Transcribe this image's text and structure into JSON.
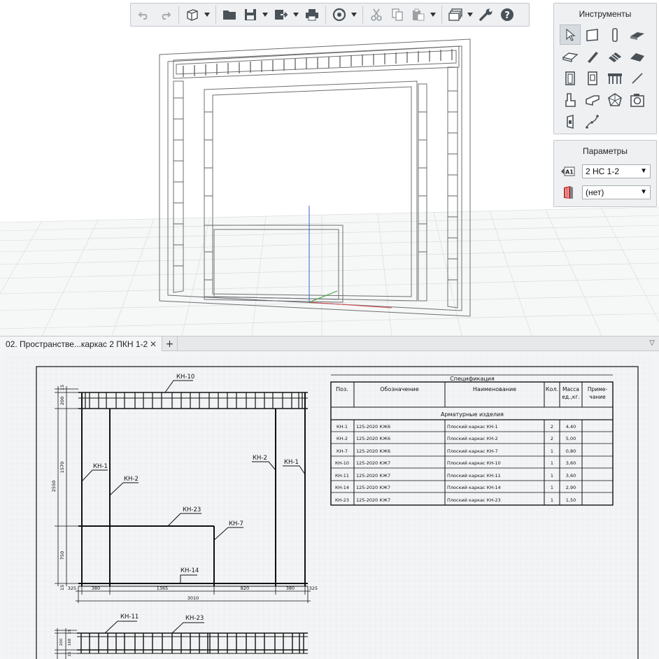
{
  "toolbar": {
    "buttons": [
      "undo-icon",
      "redo-icon",
      "new-3d-icon",
      "open-folder-icon",
      "save-icon",
      "export-icon",
      "print-icon",
      "sync-icon",
      "cut-icon",
      "copy-icon",
      "paste-icon",
      "layers-icon",
      "settings-wrench-icon",
      "help-icon"
    ]
  },
  "tools_panel": {
    "title": "Инструменты"
  },
  "params_panel": {
    "title": "Параметры",
    "style_badge": "A1",
    "style_value": "2 НС 1-2",
    "material_value": "(нет)"
  },
  "tabs": {
    "active_label": "02. Пространстве...каркас 2 ПКН 1-2",
    "close": "✕",
    "add": "+",
    "menu": "▽"
  },
  "drawing": {
    "labels": {
      "kn10": "КН-10",
      "kn1_left": "КН-1",
      "kn2_left": "КН-2",
      "kn2_right": "КН-2",
      "kn1_right": "КН-1",
      "kn23": "КН-23",
      "kn7": "КН-7",
      "kn14": "КН-14",
      "kn11_bottom": "КН-11",
      "kn23_bottom": "КН-23"
    },
    "dims_bottom": [
      "325",
      "380",
      "1365",
      "820",
      "380",
      "325"
    ],
    "dim_total": "3010",
    "dims_left": [
      "15",
      "200",
      "1570",
      "2550",
      "750",
      "15"
    ],
    "dims_bottom_view": [
      "15",
      "200",
      "168",
      "25"
    ]
  },
  "spec_table": {
    "title": "Спецификация",
    "headers": [
      "Поз.",
      "Обозначение",
      "Наименование",
      "Кол.",
      "Масса ед.,кг.",
      "Приме-чание"
    ],
    "section": "Арматурные изделия",
    "rows": [
      [
        "КН-1",
        "125-2020 КЖ6",
        "Плоский каркас КН-1",
        "2",
        "4,40",
        ""
      ],
      [
        "КН-2",
        "125-2020 КЖ6",
        "Плоский каркас КН-2",
        "2",
        "5,00",
        ""
      ],
      [
        "КН-7",
        "125-2020 КЖ6",
        "Плоский каркас КН-7",
        "1",
        "0,80",
        ""
      ],
      [
        "КН-10",
        "125-2020 КЖ7",
        "Плоский каркас КН-10",
        "1",
        "3,60",
        ""
      ],
      [
        "КН-11",
        "125-2020 КЖ7",
        "Плоский каркас КН-11",
        "1",
        "3,60",
        ""
      ],
      [
        "КН-14",
        "125-2020 КЖ7",
        "Плоский каркас КН-14",
        "1",
        "2,90",
        ""
      ],
      [
        "КН-23",
        "125-2020 КЖ7",
        "Плоский каркас КН-23",
        "1",
        "1,50",
        ""
      ]
    ]
  }
}
